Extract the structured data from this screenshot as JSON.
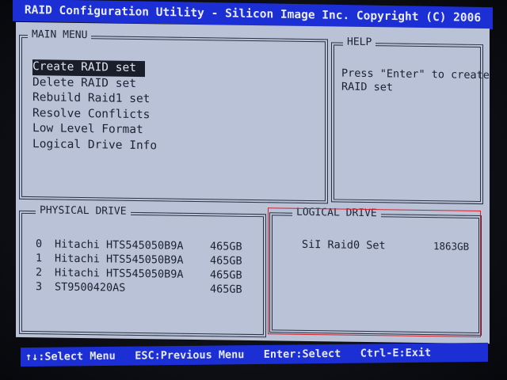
{
  "window": {
    "title": "RAID Configuration Utility - Silicon Image Inc. Copyright (C) 2006"
  },
  "main_menu": {
    "title": "MAIN MENU",
    "selected_index": 0,
    "items": [
      {
        "label": "Create RAID set"
      },
      {
        "label": "Delete RAID set"
      },
      {
        "label": "Rebuild Raid1 set"
      },
      {
        "label": "Resolve Conflicts"
      },
      {
        "label": "Low Level Format"
      },
      {
        "label": "Logical Drive Info"
      }
    ]
  },
  "help": {
    "title": "HELP",
    "line1": "Press \"Enter\" to create",
    "line2": "RAID set"
  },
  "physical_drive": {
    "title": "PHYSICAL DRIVE",
    "rows": [
      {
        "index": "0",
        "model": "Hitachi HTS545050B9A",
        "size": "465GB"
      },
      {
        "index": "1",
        "model": "Hitachi HTS545050B9A",
        "size": "465GB"
      },
      {
        "index": "2",
        "model": "Hitachi HTS545050B9A",
        "size": "465GB"
      },
      {
        "index": "3",
        "model": "ST9500420AS",
        "size": "465GB"
      }
    ]
  },
  "logical_drive": {
    "title": "LOGICAL DRIVE",
    "rows": [
      {
        "name": "SiI Raid0 Set",
        "size": "1863GB"
      }
    ]
  },
  "status_bar": {
    "select": "↑↓:Select Menu",
    "previous": "ESC:Previous Menu",
    "enter": "Enter:Select",
    "exit": "Ctrl-E:Exit"
  },
  "colors": {
    "title_bar": "#1b2fd4",
    "screen_bg": "#b9c2d6",
    "highlight_bg": "#1a1d2a",
    "annotation_red": "#d8202a"
  }
}
